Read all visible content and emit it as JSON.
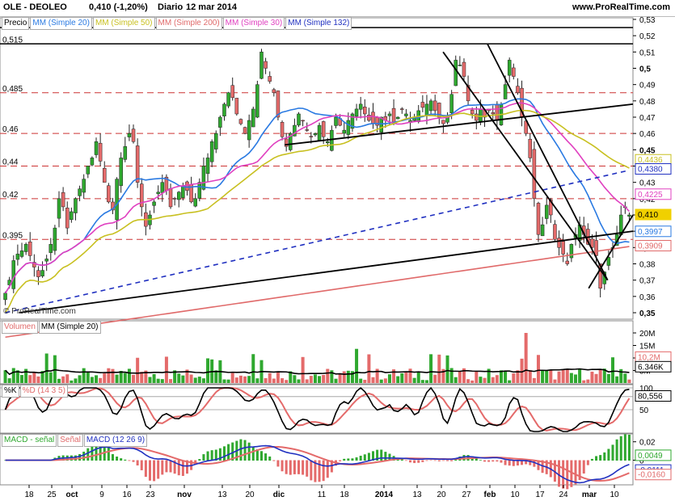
{
  "header": {
    "symbol": "OLE - DEOLEO",
    "quote": "0,410 (-1,20%)",
    "period": "Diario",
    "date": "12 mar 2014",
    "site": "www.ProRealTime.com"
  },
  "legends": {
    "price": [
      "Precio",
      "MM (Simple 20)",
      "MM (Simple 50)",
      "MM (Simple 200)",
      "MM (Simple 30)",
      "MM (Simple 132)"
    ],
    "volume": [
      "Volumen",
      "MM (Simple 20)"
    ],
    "stoch": [
      "%K",
      "%D (14 3 5)"
    ],
    "macd": [
      "MACD - señal",
      "Señal",
      "MACD (12 26 9)"
    ]
  },
  "watermark": "© ProRealTime.com",
  "colors": {
    "up": "#2fa82f",
    "down": "#e46a6a",
    "sma20": "#2a7ae2",
    "sma50": "#c8c020",
    "sma200": "#e06a6a",
    "sma30": "#e040c0",
    "sma132": "#2030c0",
    "grid_dash": "#cc3333"
  },
  "chart_data": [
    {
      "type": "candlestick",
      "panel": "price",
      "y_ticks": [
        "0,53",
        "0,52",
        "0,51",
        "0,5",
        "0,49",
        "0,48",
        "0,47",
        "0,46",
        "0,45",
        "0,44",
        "0,43",
        "0,42",
        "0,41",
        "0,4",
        "0,39",
        "0,38",
        "0,37",
        "0,36",
        "0,35"
      ],
      "ylim": [
        0.35,
        0.53
      ],
      "horizontal_levels": [
        {
          "label": "0,525",
          "value": 0.525,
          "style": "solid"
        },
        {
          "label": "0,515",
          "value": 0.515,
          "style": "solid"
        },
        {
          "label": "0,485",
          "value": 0.485,
          "style": "dashed"
        },
        {
          "label": "0,46",
          "value": 0.46,
          "style": "dashed"
        },
        {
          "label": "0,44",
          "value": 0.44,
          "style": "dashed"
        },
        {
          "label": "0,42",
          "value": 0.42,
          "style": "dashed"
        },
        {
          "label": "0,395",
          "value": 0.395,
          "style": "dashed"
        }
      ],
      "price_boxes": [
        {
          "label": "0,4436",
          "value": 0.4436,
          "color": "#c8c020"
        },
        {
          "label": "0,4380",
          "value": 0.438,
          "color": "#2030c0"
        },
        {
          "label": "0,4225",
          "value": 0.4225,
          "color": "#e040c0"
        },
        {
          "label": "0,410",
          "value": 0.41,
          "color": "#f0d000"
        },
        {
          "label": "0,3997",
          "value": 0.3997,
          "color": "#2a7ae2"
        },
        {
          "label": "0,3909",
          "value": 0.3909,
          "color": "#e06a6a"
        }
      ],
      "closes": [
        0.362,
        0.37,
        0.382,
        0.386,
        0.388,
        0.392,
        0.385,
        0.378,
        0.372,
        0.376,
        0.383,
        0.392,
        0.402,
        0.42,
        0.415,
        0.402,
        0.412,
        0.42,
        0.426,
        0.432,
        0.44,
        0.445,
        0.455,
        0.443,
        0.43,
        0.418,
        0.413,
        0.432,
        0.445,
        0.452,
        0.46,
        0.455,
        0.43,
        0.415,
        0.403,
        0.41,
        0.418,
        0.424,
        0.43,
        0.425,
        0.415,
        0.42,
        0.424,
        0.428,
        0.425,
        0.418,
        0.42,
        0.43,
        0.44,
        0.445,
        0.455,
        0.46,
        0.47,
        0.478,
        0.485,
        0.482,
        0.472,
        0.466,
        0.46,
        0.468,
        0.475,
        0.49,
        0.51,
        0.5,
        0.492,
        0.485,
        0.47,
        0.458,
        0.452,
        0.46,
        0.465,
        0.472,
        0.468,
        0.462,
        0.458,
        0.46,
        0.465,
        0.458,
        0.455,
        0.462,
        0.47,
        0.465,
        0.462,
        0.468,
        0.472,
        0.475,
        0.478,
        0.472,
        0.468,
        0.466,
        0.465,
        0.47,
        0.468,
        0.472,
        0.466,
        0.47,
        0.475,
        0.472,
        0.468,
        0.47,
        0.474,
        0.476,
        0.478,
        0.48,
        0.474,
        0.47,
        0.466,
        0.47,
        0.484,
        0.505,
        0.502,
        0.495,
        0.48,
        0.472,
        0.468,
        0.475,
        0.47,
        0.474,
        0.472,
        0.468,
        0.478,
        0.49,
        0.505,
        0.495,
        0.485,
        0.47,
        0.46,
        0.445,
        0.42,
        0.398,
        0.404,
        0.416,
        0.41,
        0.395,
        0.39,
        0.386,
        0.38,
        0.392,
        0.398,
        0.404,
        0.398,
        0.392,
        0.39,
        0.385,
        0.365,
        0.375,
        0.384,
        0.39,
        0.398,
        0.41,
        0.415,
        0.41
      ],
      "sma20_line": "x=0-175: rising from 0.36 to 0.47, flat 0.47 to 0.48 through feb, falls to 0.3997",
      "sma30_line": "rising from 0.37 to 0.475, falls to 0.4225",
      "sma50_line": "rising from 0.35 to 0.47, falls to 0.4436",
      "sma132_line": "dashed rising 0.35 to 0.438",
      "sma200_line": "rising 0.35 to 0.3909"
    },
    {
      "type": "bar",
      "panel": "volume",
      "y_ticks": [
        "20M",
        "15M",
        "10M",
        "5M"
      ],
      "ylim": [
        0,
        20
      ],
      "price_boxes": [
        {
          "label": "10,2M",
          "value": 10.2,
          "color": "#e46a6a"
        },
        {
          "label": "6.346K",
          "value": 6.346,
          "color": "#000000"
        }
      ]
    },
    {
      "type": "line",
      "panel": "stochastic",
      "y_ticks": [
        "100",
        "80",
        "50"
      ],
      "ylim": [
        0,
        100
      ],
      "price_boxes": [
        {
          "label": "80,556",
          "value": 80.556,
          "color": "#000000"
        }
      ]
    },
    {
      "type": "bar",
      "panel": "macd",
      "y_ticks": [
        "0,02",
        "0"
      ],
      "ylim": [
        -0.025,
        0.025
      ],
      "price_boxes": [
        {
          "label": "0,0049",
          "value": 0.0049,
          "color": "#2fa82f"
        },
        {
          "label": "-0,0111",
          "value": -0.0111,
          "color": "#2030c0"
        },
        {
          "label": "-0,0160",
          "value": -0.016,
          "color": "#e06a6a"
        }
      ]
    }
  ],
  "x_axis": {
    "ticks": [
      "18",
      "25",
      "oct",
      "9",
      "16",
      "23",
      "nov",
      "13",
      "20",
      "dic",
      "11",
      "18",
      "2014",
      "13",
      "20",
      "27",
      "feb",
      "10",
      "17",
      "24",
      "mar",
      "10"
    ]
  }
}
